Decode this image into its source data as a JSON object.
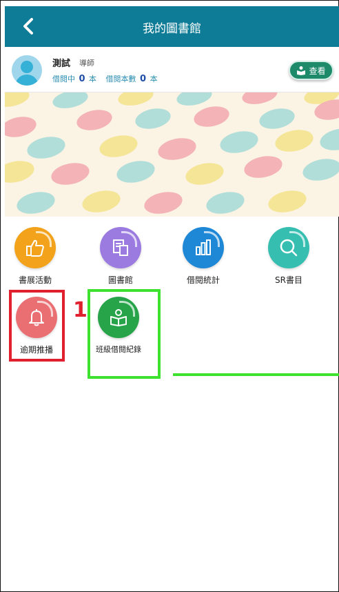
{
  "header": {
    "title": "我的圖書館",
    "back_icon": "chevron-left-icon"
  },
  "profile": {
    "name": "測試",
    "role": "導師",
    "borrowing_label": "借閱中",
    "borrowing_count": "0",
    "borrowing_unit": "本",
    "borrowed_total_label": "借閱本數",
    "borrowed_total_count": "0",
    "borrowed_total_unit": "本",
    "view_button": "查看"
  },
  "menu": [
    {
      "label": "書展活動",
      "icon": "thumbs-up-icon",
      "color": "#f3a31b"
    },
    {
      "label": "圖書館",
      "icon": "library-books-icon",
      "color": "#9b7be0"
    },
    {
      "label": "借閱統計",
      "icon": "bar-chart-icon",
      "color": "#1e88d6"
    },
    {
      "label": "SR書目",
      "icon": "search-icon",
      "color": "#36bfb1"
    },
    {
      "label": "逾期推播",
      "icon": "bell-icon",
      "color": "#ea6f73"
    },
    {
      "label": "班級借閱紀錄",
      "icon": "reader-icon",
      "color": "#27a34a"
    }
  ],
  "annotation": {
    "step": "1",
    "highlight_colors": [
      "#e0202f",
      "#3fe12f"
    ]
  }
}
